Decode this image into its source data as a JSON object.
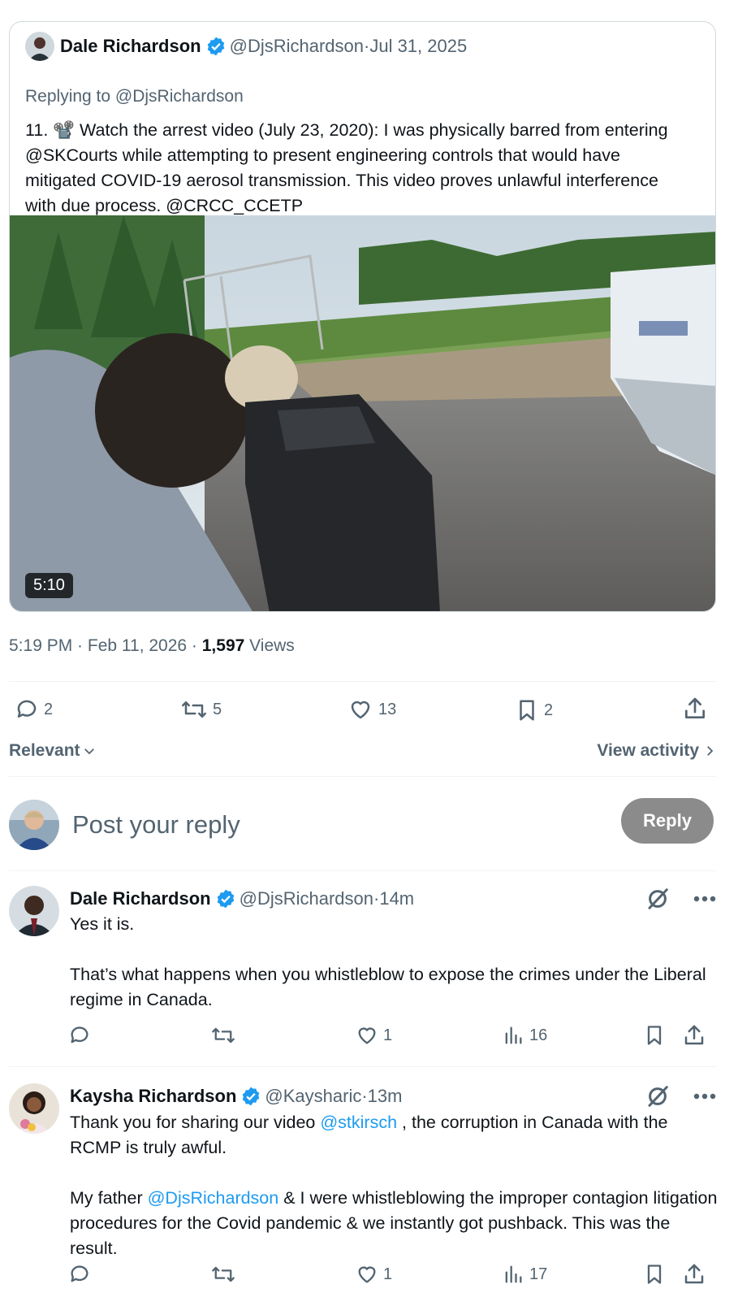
{
  "quoted": {
    "name": "Dale Richardson",
    "handle": "@DjsRichardson",
    "sep": " · ",
    "date": "Jul 31, 2025",
    "replying": "Replying to @DjsRichardson",
    "text": "11. 📽️ Watch the arrest video (July 23, 2020): I was physically barred from entering @SKCourts while attempting to present engineering controls that would have mitigated COVID-19 aerosol transmission. This video proves unlawful interference with due process. @CRCC_CCETP",
    "video_duration": "5:10"
  },
  "meta": {
    "time": "5:19 PM · Feb 11, 2026 · ",
    "views_count": "1,597",
    "views_label": " Views"
  },
  "actions": {
    "replies": "2",
    "reposts": "5",
    "likes": "13",
    "bookmarks": "2"
  },
  "sort": {
    "label": "Relevant",
    "activity": "View activity"
  },
  "compose": {
    "placeholder": "Post your reply",
    "button": "Reply"
  },
  "replies": [
    {
      "name": "Dale Richardson",
      "handle": "@DjsRichardson",
      "time": "14m",
      "paragraphs": [
        "Yes it is.",
        "That’s what happens when you whistleblow to expose the crimes under the Liberal regime in Canada."
      ],
      "likes": "1",
      "views": "16"
    },
    {
      "name": "Kaysha Richardson",
      "handle": "@Kaysharic",
      "time": "13m",
      "p1_a": "Thank you for sharing our video ",
      "p1_mention": "@stkirsch",
      "p1_b": " , the corruption in Canada with the RCMP is truly awful.",
      "p2_a": "My father ",
      "p2_mention": "@DjsRichardson",
      "p2_b": " & I were whistleblowing the improper contagion litigation procedures for the Covid pandemic & we instantly got pushback. This was the result.",
      "likes": "1",
      "views": "17"
    }
  ],
  "colors": {
    "verified": "#1d9bf0",
    "mention": "#1d9bf0",
    "reply_button": "#8b8b8b"
  }
}
